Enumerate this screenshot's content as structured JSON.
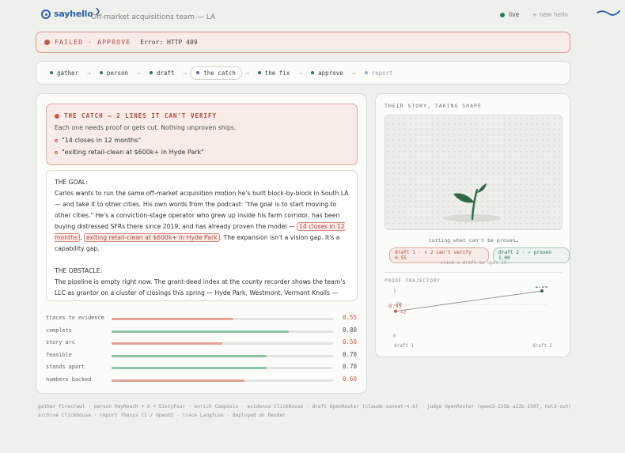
{
  "header": {
    "brand": "sayhello",
    "team": "Off-market acquisitions team — LA",
    "live_label": "live",
    "new_hello_label": "new hello"
  },
  "banner": {
    "status": "FAILED · APPROVE",
    "error": "Error: HTTP 409"
  },
  "pipeline": {
    "steps": [
      {
        "label": "gather"
      },
      {
        "label": "person"
      },
      {
        "label": "draft"
      },
      {
        "label": "the catch"
      },
      {
        "label": "the fix"
      },
      {
        "label": "approve"
      },
      {
        "label": "report"
      }
    ],
    "active_step": "the catch"
  },
  "catch": {
    "title": "THE CATCH — 2 LINES IT CAN'T VERIFY",
    "subtitle": "Each one needs proof or gets cut. Nothing unproven ships.",
    "items": [
      "\"14 closes in 12 months\"",
      "\"exiting retail-clean at $600k+ in Hyde Park\""
    ]
  },
  "document": {
    "goal_heading": "THE GOAL:",
    "goal_text_1": "Carlos wants to run the same off-market acquisition motion he's built block-by-block in South LA — and take it to other cities. His own words from the podcast: \"the goal is to start moving to other cities.\" He's a conviction-stage operator who grew up inside his farm corridor, has been buying distressed SFRs there since 2019, and has already proven the model — ",
    "goal_hl_1": "14 closes in 12 months",
    "goal_sep": ", ",
    "goal_hl_2": "exiting retail-clean at $600k+ in Hyde Park",
    "goal_text_2": ". The expansion isn't a vision gap. It's a capability gap.",
    "obstacle_heading": "THE OBSTACLE:",
    "obstacle_text": "The pipeline is empty right now. The grant-deed index at the county recorder shows the team's LLC as grantor on a cluster of closings this spring — Hyde Park, Westmont, Vermont Knolls — with no new acquisition deeds recorded since [title_transfer]. Carlos confirmed it on the podcast himself:"
  },
  "metrics": [
    {
      "label": "traces to evidence",
      "value": 0.55,
      "display": "0.55",
      "status": "bad"
    },
    {
      "label": "complete",
      "value": 0.8,
      "display": "0.80",
      "status": "good"
    },
    {
      "label": "story arc",
      "value": 0.5,
      "display": "0.50",
      "status": "bad"
    },
    {
      "label": "feasible",
      "value": 0.7,
      "display": "0.70",
      "status": "good"
    },
    {
      "label": "stands apart",
      "value": 0.7,
      "display": "0.70",
      "status": "good"
    },
    {
      "label": "numbers backed",
      "value": 0.6,
      "display": "0.60",
      "status": "bad"
    }
  ],
  "story": {
    "title": "THEIR STORY, TAKING SHAPE",
    "caption": "cutting what can't be proven…",
    "drafts": [
      {
        "label": "draft 1 · ✕ 2 can't verify 0.55",
        "status": "bad"
      },
      {
        "label": "draft 2 · ✓ proven 1.00",
        "status": "good"
      }
    ],
    "hint": "click a draft to open it"
  },
  "proof_trajectory": {
    "title": "PROOF TRAJECTORY"
  },
  "chart_data": {
    "type": "line",
    "categories": [
      "draft 1",
      "draft 2"
    ],
    "series": [
      {
        "values": [
          0.55,
          1.0
        ]
      }
    ],
    "point_labels": [
      "0.55",
      "1.00"
    ],
    "ticks": [
      "1",
      ".70",
      "0"
    ],
    "annotation": "✕2",
    "ylim": [
      0,
      1
    ],
    "threshold": 0.7
  },
  "footer": {
    "text": "gather Firecrawl · person HeyReach + X + SixtyFour · enrich Composio · evidence ClickHouse · draft OpenRouter (claude-sonnet-4.6) · judge OpenRouter (qwen3-235b-a22b-2507, held-out) · archive ClickHouse · report Thesys C1 / OpenUI · trace Langfuse · deployed on Render"
  },
  "colors": {
    "good": "#8fc2a2",
    "bad": "#e5a29a",
    "good_text": "#2f6a47",
    "bad_text": "#c4594a",
    "accent": "#2b5fa8"
  },
  "icons": {
    "live": "green-dot-icon",
    "new_hello": "plus-icon",
    "brand": "sayhello-logo-icon",
    "corner": "swoosh-icon",
    "story": "sprout-icon"
  }
}
